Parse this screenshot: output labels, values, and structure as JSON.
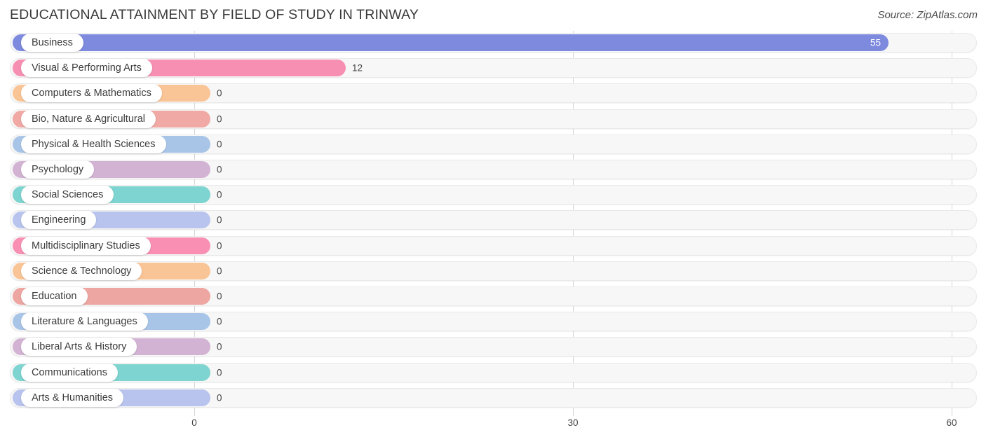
{
  "header": {
    "title": "EDUCATIONAL ATTAINMENT BY FIELD OF STUDY IN TRINWAY",
    "source": "Source: ZipAtlas.com"
  },
  "chart_data": {
    "type": "bar",
    "orientation": "horizontal",
    "title": "EDUCATIONAL ATTAINMENT BY FIELD OF STUDY IN TRINWAY",
    "xlabel": "",
    "ylabel": "",
    "xlim": [
      0,
      60
    ],
    "xticks": [
      0,
      30,
      60
    ],
    "xtick_labels": [
      "0",
      "30",
      "60"
    ],
    "grid": true,
    "legend": false,
    "categories": [
      "Business",
      "Visual & Performing Arts",
      "Computers & Mathematics",
      "Bio, Nature & Agricultural",
      "Physical & Health Sciences",
      "Psychology",
      "Social Sciences",
      "Engineering",
      "Multidisciplinary Studies",
      "Science & Technology",
      "Education",
      "Literature & Languages",
      "Liberal Arts & History",
      "Communications",
      "Arts & Humanities"
    ],
    "values": [
      55,
      12,
      0,
      0,
      0,
      0,
      0,
      0,
      0,
      0,
      0,
      0,
      0,
      0,
      0
    ],
    "value_labels": [
      "55",
      "12",
      "0",
      "0",
      "0",
      "0",
      "0",
      "0",
      "0",
      "0",
      "0",
      "0",
      "0",
      "0",
      "0"
    ],
    "colors": [
      "#7d8ade",
      "#f78fb3",
      "#fac596",
      "#f0a9a4",
      "#a8c5e8",
      "#d3b3d4",
      "#7ed4d0",
      "#b8c4ee",
      "#f990b4",
      "#fac596",
      "#eda6a1",
      "#a8c5e8",
      "#d3b3d4",
      "#7ed4d0",
      "#b8c4ee"
    ]
  }
}
